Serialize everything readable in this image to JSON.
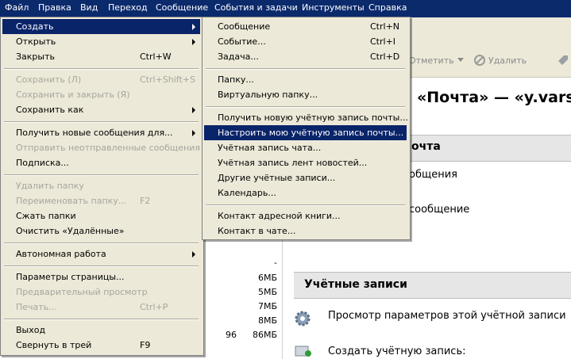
{
  "menubar": [
    "Файл",
    "Правка",
    "Вид",
    "Переход",
    "Сообщение",
    "События и задачи",
    "Инструменты",
    "Справка"
  ],
  "toolbar": {
    "mark_label": "Отметить",
    "delete_label": "Удалить"
  },
  "heading": "«Почта» — «y.vars",
  "section_mail": "очта",
  "mail_lines": [
    "общения",
    "сообщение"
  ],
  "section_accounts": "Учётные записи",
  "account_lines": [
    "Просмотр параметров этой учётной записи",
    "Создать учётную запись:"
  ],
  "folder_stats": [
    {
      "left": "",
      "right": "-"
    },
    {
      "left": "",
      "right": "6МБ"
    },
    {
      "left": "",
      "right": "5МБ"
    },
    {
      "left": "",
      "right": "7МБ"
    },
    {
      "left": "",
      "right": "8МБ"
    },
    {
      "left": "96",
      "right": "86МБ"
    }
  ],
  "file_menu": [
    {
      "label": "Создать",
      "shortcut": "",
      "submenu": true,
      "state": "selected"
    },
    {
      "label": "Открыть",
      "shortcut": "",
      "submenu": true,
      "state": "normal"
    },
    {
      "label": "Закрыть",
      "shortcut": "Ctrl+W",
      "submenu": false,
      "state": "normal"
    },
    {
      "label": "Сохранить (Л)",
      "shortcut": "Ctrl+Shift+S",
      "submenu": false,
      "state": "disabled"
    },
    {
      "label": "Сохранить и закрыть (Я)",
      "shortcut": "",
      "submenu": false,
      "state": "disabled"
    },
    {
      "label": "Сохранить как",
      "shortcut": "",
      "submenu": true,
      "state": "normal"
    },
    {
      "label": "Получить новые сообщения для...",
      "shortcut": "",
      "submenu": true,
      "state": "normal"
    },
    {
      "label": "Отправить неотправленные сообщения",
      "shortcut": "",
      "submenu": false,
      "state": "disabled"
    },
    {
      "label": "Подписка...",
      "shortcut": "",
      "submenu": false,
      "state": "normal"
    },
    {
      "label": "Удалить папку",
      "shortcut": "",
      "submenu": false,
      "state": "disabled"
    },
    {
      "label": "Переименовать папку...",
      "shortcut": "F2",
      "submenu": false,
      "state": "disabled"
    },
    {
      "label": "Сжать папки",
      "shortcut": "",
      "submenu": false,
      "state": "normal"
    },
    {
      "label": "Очистить «Удалённые»",
      "shortcut": "",
      "submenu": false,
      "state": "normal"
    },
    {
      "label": "Автономная работа",
      "shortcut": "",
      "submenu": true,
      "state": "normal"
    },
    {
      "label": "Параметры страницы...",
      "shortcut": "",
      "submenu": false,
      "state": "normal"
    },
    {
      "label": "Предварительный просмотр",
      "shortcut": "",
      "submenu": false,
      "state": "disabled"
    },
    {
      "label": "Печать...",
      "shortcut": "Ctrl+P",
      "submenu": false,
      "state": "disabled"
    },
    {
      "label": "Выход",
      "shortcut": "",
      "submenu": false,
      "state": "normal"
    },
    {
      "label": "Свернуть в трей",
      "shortcut": "F9",
      "submenu": false,
      "state": "normal"
    }
  ],
  "create_menu": [
    {
      "label": "Сообщение",
      "shortcut": "Ctrl+N",
      "state": "normal"
    },
    {
      "label": "Событие...",
      "shortcut": "Ctrl+I",
      "state": "normal"
    },
    {
      "label": "Задача...",
      "shortcut": "Ctrl+D",
      "state": "normal"
    },
    {
      "label": "Папку...",
      "shortcut": "",
      "state": "normal"
    },
    {
      "label": "Виртуальную папку...",
      "shortcut": "",
      "state": "normal"
    },
    {
      "label": "Получить новую учётную запись почты...",
      "shortcut": "",
      "state": "normal"
    },
    {
      "label": "Настроить мою учётную запись почты...",
      "shortcut": "",
      "state": "selected"
    },
    {
      "label": "Учётная запись чата...",
      "shortcut": "",
      "state": "normal"
    },
    {
      "label": "Учётная запись лент новостей...",
      "shortcut": "",
      "state": "normal"
    },
    {
      "label": "Другие учётные записи...",
      "shortcut": "",
      "state": "normal"
    },
    {
      "label": "Календарь...",
      "shortcut": "",
      "state": "normal"
    },
    {
      "label": "Контакт адресной книги...",
      "shortcut": "",
      "state": "normal"
    },
    {
      "label": "Контакт в чате...",
      "shortcut": "",
      "state": "normal"
    }
  ]
}
